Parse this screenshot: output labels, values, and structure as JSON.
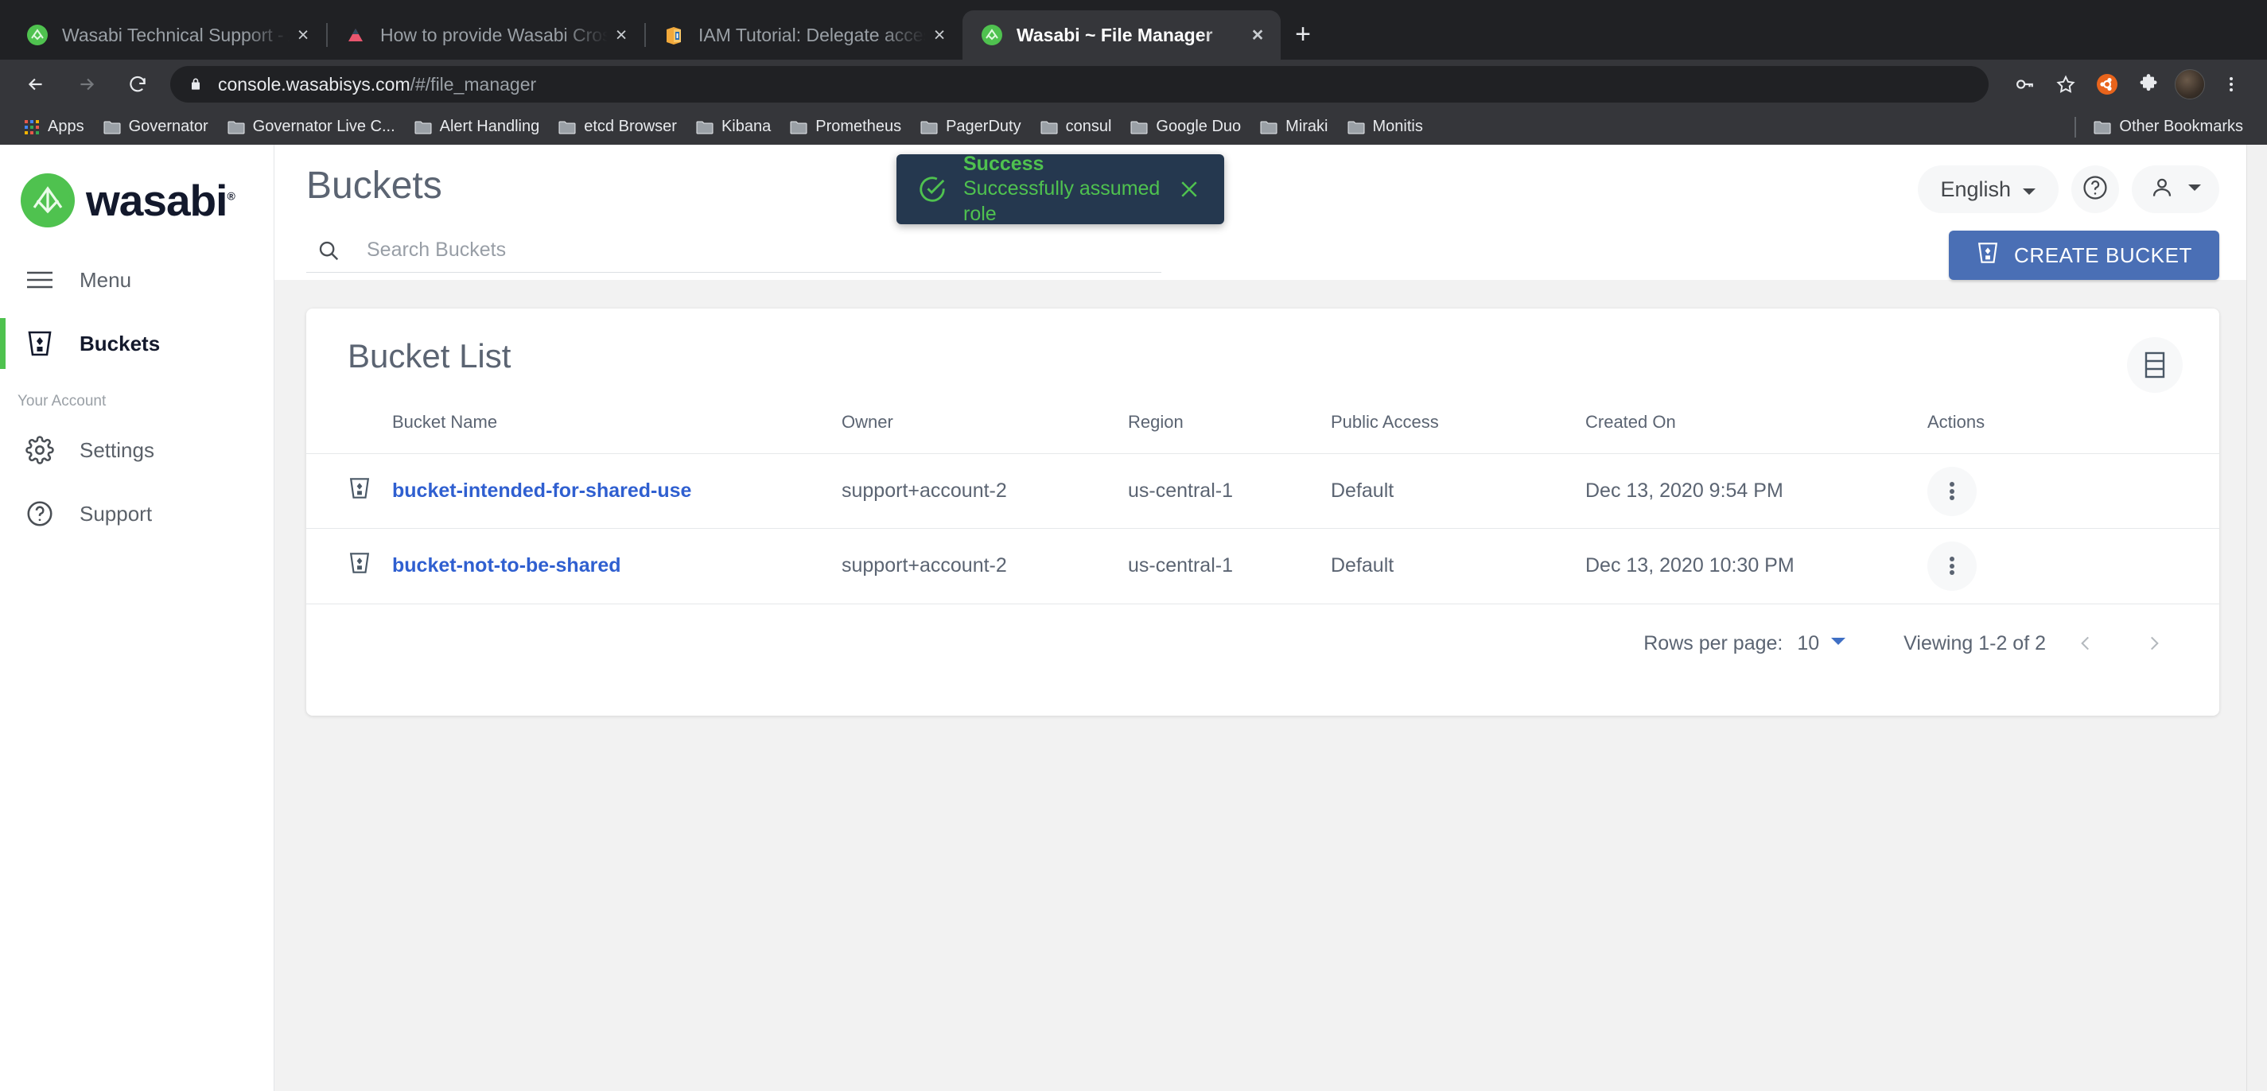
{
  "browser": {
    "tabs": [
      {
        "title": "Wasabi Technical Support - Ag",
        "favicon": "wasabi-icon",
        "active": false
      },
      {
        "title": "How to provide Wasabi Cross A",
        "favicon": "triangle-red-icon",
        "active": false
      },
      {
        "title": "IAM Tutorial: Delegate access a",
        "favicon": "aws-iam-icon",
        "active": false
      },
      {
        "title": "Wasabi ~ File Manager",
        "favicon": "wasabi-icon",
        "active": true
      }
    ],
    "new_tab_label": "+",
    "close_label": "×",
    "nav": {
      "back": "back-arrow-icon",
      "forward": "forward-arrow-icon",
      "reload": "reload-icon"
    },
    "omnibox": {
      "lock": "lock-icon",
      "domain": "console.wasabisys.com",
      "path": "/#/file_manager"
    },
    "toolbar_icons": [
      "key-icon",
      "star-icon",
      "ubuntu-icon",
      "extensions-puzzle-icon",
      "profile-avatar",
      "chrome-menu-icon"
    ],
    "bookmarks": {
      "apps_label": "Apps",
      "items": [
        "Governator",
        "Governator Live C...",
        "Alert Handling",
        "etcd Browser",
        "Kibana",
        "Prometheus",
        "PagerDuty",
        "consul",
        "Google Duo",
        "Miraki",
        "Monitis"
      ],
      "other_bookmarks": "Other Bookmarks"
    }
  },
  "sidebar": {
    "logo_text": "wasabi",
    "logo_mark": "wasabi-leaf-icon",
    "items": [
      {
        "label": "Menu",
        "icon": "hamburger-icon",
        "active": false
      },
      {
        "label": "Buckets",
        "icon": "bucket-icon",
        "active": true
      }
    ],
    "section_label": "Your Account",
    "account_items": [
      {
        "label": "Settings",
        "icon": "gear-icon"
      },
      {
        "label": "Support",
        "icon": "question-circle-icon"
      }
    ]
  },
  "header": {
    "title": "Buckets",
    "language": {
      "label": "English",
      "caret": "chevron-down-icon"
    },
    "help_icon": "question-circle-icon",
    "user": {
      "icon": "person-icon",
      "caret": "chevron-down-icon"
    }
  },
  "search": {
    "icon": "search-icon",
    "placeholder": "Search Buckets",
    "value": ""
  },
  "create_button": {
    "label": "CREATE BUCKET",
    "icon": "bucket-icon",
    "color": "#4a6fb5"
  },
  "toast": {
    "icon": "check-circle-icon",
    "title": "Success",
    "message": "Successfully assumed role",
    "close_icon": "close-icon",
    "background": "#25384f",
    "accent": "#4fc24f"
  },
  "bucket_list": {
    "title": "Bucket List",
    "view_toggle_icon": "list-view-icon",
    "columns": [
      "",
      "Bucket Name",
      "Owner",
      "Region",
      "Public Access",
      "Created On",
      "Actions"
    ],
    "rows": [
      {
        "icon": "bucket-icon",
        "name": "bucket-intended-for-shared-use",
        "owner": "support+account-2",
        "region": "us-central-1",
        "public_access": "Default",
        "created_on": "Dec 13, 2020 9:54 PM",
        "actions_icon": "kebab-menu-icon"
      },
      {
        "icon": "bucket-icon",
        "name": "bucket-not-to-be-shared",
        "owner": "support+account-2",
        "region": "us-central-1",
        "public_access": "Default",
        "created_on": "Dec 13, 2020 10:30 PM",
        "actions_icon": "kebab-menu-icon"
      }
    ],
    "footer": {
      "rows_per_page_label": "Rows per page:",
      "rows_per_page_value": "10",
      "rows_per_page_caret": "chevron-down-icon",
      "viewing": "Viewing 1-2 of 2",
      "prev_icon": "chevron-left-icon",
      "next_icon": "chevron-right-icon"
    }
  }
}
